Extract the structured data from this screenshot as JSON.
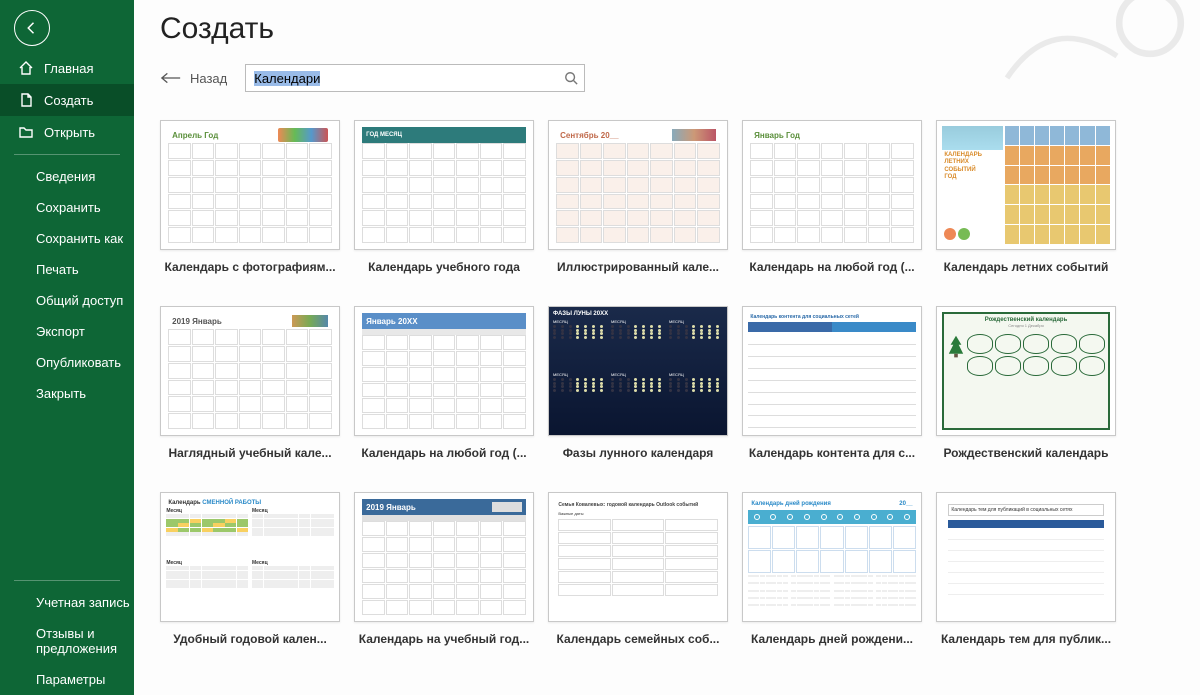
{
  "sidebar": {
    "nav_primary": [
      {
        "icon": "home",
        "label": "Главная"
      },
      {
        "icon": "file",
        "label": "Создать"
      },
      {
        "icon": "folder",
        "label": "Открыть"
      }
    ],
    "nav_secondary": [
      {
        "label": "Сведения"
      },
      {
        "label": "Сохранить"
      },
      {
        "label": "Сохранить как"
      },
      {
        "label": "Печать"
      },
      {
        "label": "Общий доступ"
      },
      {
        "label": "Экспорт"
      },
      {
        "label": "Опубликовать"
      },
      {
        "label": "Закрыть"
      }
    ],
    "nav_footer": [
      {
        "label": "Учетная запись"
      },
      {
        "label": "Отзывы и предложения"
      },
      {
        "label": "Параметры"
      }
    ]
  },
  "page": {
    "title": "Создать",
    "back_label": "Назад",
    "search_value": "Календари"
  },
  "templates": [
    {
      "label": "Календарь с фотографиям...",
      "preview_title": "Апрель Год",
      "style": "photo"
    },
    {
      "label": "Календарь учебного года",
      "preview_title": "ГОД   МЕСЯЦ",
      "style": "acad"
    },
    {
      "label": "Иллюстрированный кале...",
      "preview_title": "Сентябрь 20__",
      "style": "illus"
    },
    {
      "label": "Календарь на любой год (...",
      "preview_title": "Январь Год",
      "style": "any1"
    },
    {
      "label": "Календарь летних событий",
      "preview_title": "КАЛЕНДАРЬ ЛЕТНИХ СОБЫТИЙ ГОД",
      "style": "summer"
    },
    {
      "label": "Наглядный учебный кале...",
      "preview_title": "2019  Январь",
      "style": "visual"
    },
    {
      "label": "Календарь на любой год (...",
      "preview_title": "Январь 20XX",
      "style": "any2"
    },
    {
      "label": "Фазы лунного календаря",
      "preview_title": "ФАЗЫ ЛУНЫ 20XX",
      "style": "moon"
    },
    {
      "label": "Календарь контента для с...",
      "preview_title": "Календарь контента для социальных сетей",
      "style": "social"
    },
    {
      "label": "Рождественский календарь",
      "preview_title": "Рождественский календарь",
      "style": "xmas"
    },
    {
      "label": "Удобный годовой кален...",
      "preview_title": "Календарь СМЕННОЙ РАБОТЫ",
      "style": "shift"
    },
    {
      "label": "Календарь на учебный год...",
      "preview_title": "2019 Январь",
      "style": "acad2"
    },
    {
      "label": "Календарь семейных соб...",
      "preview_title": "Семья Ковалевых: годовой календарь Outlook событий",
      "style": "family"
    },
    {
      "label": "Календарь дней рождени...",
      "preview_title": "Календарь дней рождения   20__",
      "style": "bday"
    },
    {
      "label": "Календарь тем для публик...",
      "preview_title": "Календарь тем для публикаций в социальных сетях",
      "style": "themes"
    }
  ],
  "colors": {
    "brand": "#0e6636",
    "brand_dark": "#094e28"
  }
}
